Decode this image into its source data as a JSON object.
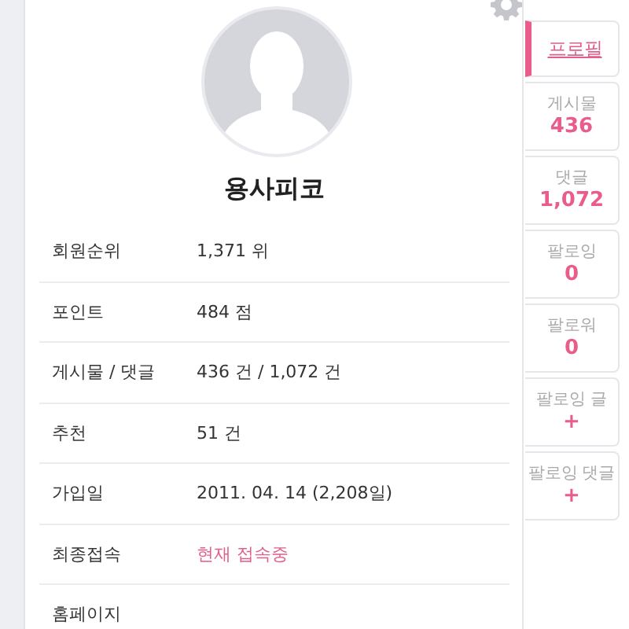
{
  "profile": {
    "name": "용사피코"
  },
  "rows": [
    {
      "label": "회원순위",
      "value": "1,371 위",
      "emphasis": false
    },
    {
      "label": "포인트",
      "value": "484 점",
      "emphasis": false
    },
    {
      "label": "게시물 / 댓글",
      "value": "436 건 / 1,072 건",
      "emphasis": false
    },
    {
      "label": "추천",
      "value": "51 건",
      "emphasis": false
    },
    {
      "label": "가입일",
      "value": "2011. 04. 14 (2,208일)",
      "emphasis": false
    },
    {
      "label": "최종접속",
      "value": "현재 접속중",
      "emphasis": true
    },
    {
      "label": "홈페이지"
    }
  ],
  "tabs": [
    {
      "label": "프로필",
      "selected": true
    },
    {
      "label": "게시물",
      "value": "436",
      "selected": false
    },
    {
      "label": "댓글",
      "value": "1,072",
      "selected": false
    },
    {
      "label": "팔로잉",
      "value": "0",
      "selected": false
    },
    {
      "label": "팔로워",
      "value": "0",
      "selected": false
    },
    {
      "label": "팔로잉 글",
      "value": "+",
      "selected": false
    },
    {
      "label": "팔로잉 댓글",
      "value": "+",
      "selected": false
    }
  ]
}
